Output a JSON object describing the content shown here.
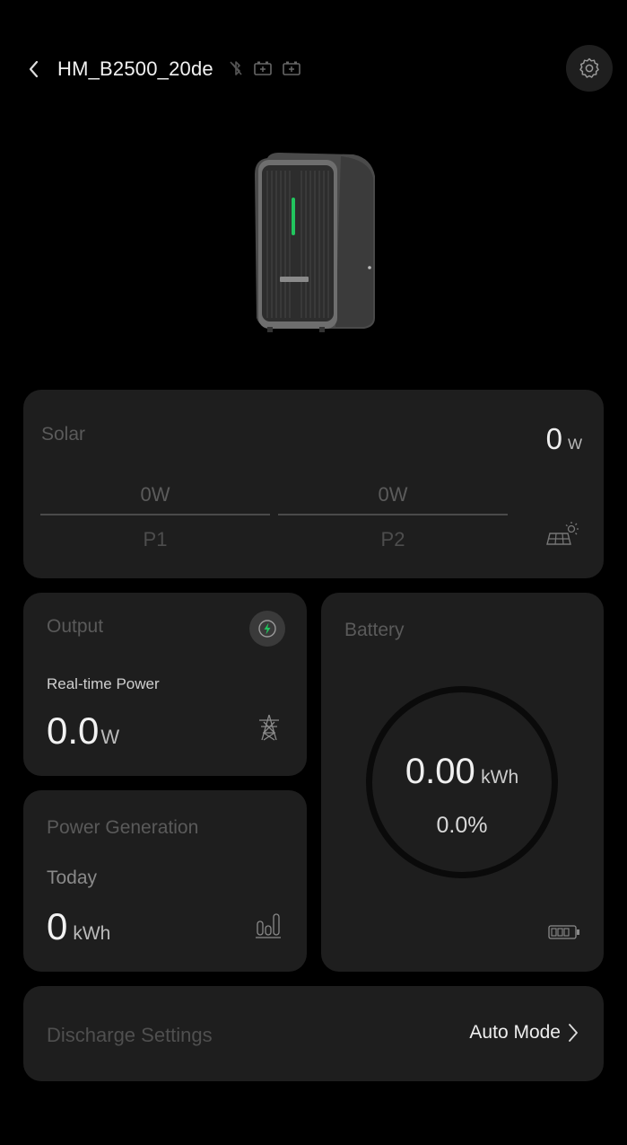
{
  "header": {
    "title": "HM_B2500_20de",
    "icons": [
      "bluetooth-off-icon",
      "battery-pack-icon",
      "battery-pack-icon"
    ]
  },
  "solar": {
    "label": "Solar",
    "total_value": "0",
    "total_unit": "W",
    "pv": [
      {
        "value": "0W",
        "name": "P1"
      },
      {
        "value": "0W",
        "name": "P2"
      }
    ]
  },
  "output": {
    "label": "Output",
    "sub_label": "Real-time Power",
    "value": "0.0",
    "unit": "W"
  },
  "generation": {
    "label": "Power Generation",
    "period": "Today",
    "value": "0",
    "unit": "kWh"
  },
  "battery": {
    "label": "Battery",
    "energy": "0.00",
    "unit": "kWh",
    "percent": "0.0%"
  },
  "discharge": {
    "label": "Discharge Settings",
    "mode": "Auto Mode"
  },
  "colors": {
    "background": "#000000",
    "card": "#1e1e1e",
    "indicator_green": "#22c55e"
  }
}
